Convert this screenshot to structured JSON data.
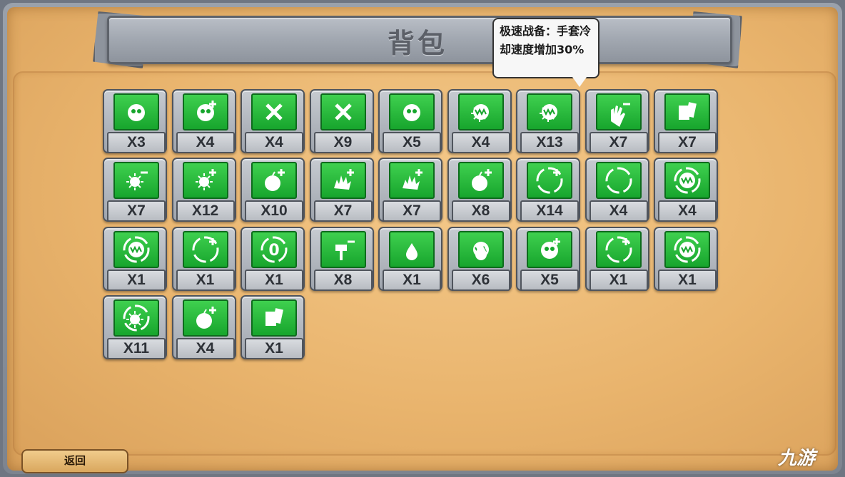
{
  "header": {
    "title": "背包"
  },
  "tooltip": {
    "text": "极速战备：手套冷却速度增加30%"
  },
  "inventory": [
    {
      "count": "X3",
      "icon": "eye-orb-icon"
    },
    {
      "count": "X4",
      "icon": "orb-plus-icon"
    },
    {
      "count": "X4",
      "icon": "target-cross-icon"
    },
    {
      "count": "X9",
      "icon": "crossed-fists-icon"
    },
    {
      "count": "X5",
      "icon": "eye-swirl-icon"
    },
    {
      "count": "X4",
      "icon": "sun-face-icon"
    },
    {
      "count": "X13",
      "icon": "sun-face-crown-icon"
    },
    {
      "count": "X7",
      "icon": "glove-minus-icon"
    },
    {
      "count": "X7",
      "icon": "card-shield-icon"
    },
    {
      "count": "X7",
      "icon": "sunburst-minus-icon"
    },
    {
      "count": "X12",
      "icon": "sunburst-plus-icon"
    },
    {
      "count": "X10",
      "icon": "bomb-plus-icon"
    },
    {
      "count": "X7",
      "icon": "spiky-plus-icon"
    },
    {
      "count": "X7",
      "icon": "spiky-beast-plus-icon"
    },
    {
      "count": "X8",
      "icon": "apple-plus-icon"
    },
    {
      "count": "X14",
      "icon": "heart-plus-ring-icon"
    },
    {
      "count": "X4",
      "icon": "fan-ring-icon"
    },
    {
      "count": "X4",
      "icon": "fangs-ring-icon"
    },
    {
      "count": "X1",
      "icon": "fangs-ring-icon"
    },
    {
      "count": "X1",
      "icon": "plus-ring-icon"
    },
    {
      "count": "X1",
      "icon": "zero-ring-icon"
    },
    {
      "count": "X8",
      "icon": "hammer-minus-icon"
    },
    {
      "count": "X1",
      "icon": "drop-dots-icon"
    },
    {
      "count": "X6",
      "icon": "fangs-drop-icon"
    },
    {
      "count": "X5",
      "icon": "double-orb-plus-icon"
    },
    {
      "count": "X1",
      "icon": "plus-ring-plus-icon"
    },
    {
      "count": "X1",
      "icon": "fangs-ring-icon"
    },
    {
      "count": "X11",
      "icon": "sun-ring-icon"
    },
    {
      "count": "X4",
      "icon": "apple-plus-icon"
    },
    {
      "count": "X1",
      "icon": "tools-book-icon"
    }
  ],
  "footer": {
    "back_label": "返回",
    "watermark": "九游"
  }
}
